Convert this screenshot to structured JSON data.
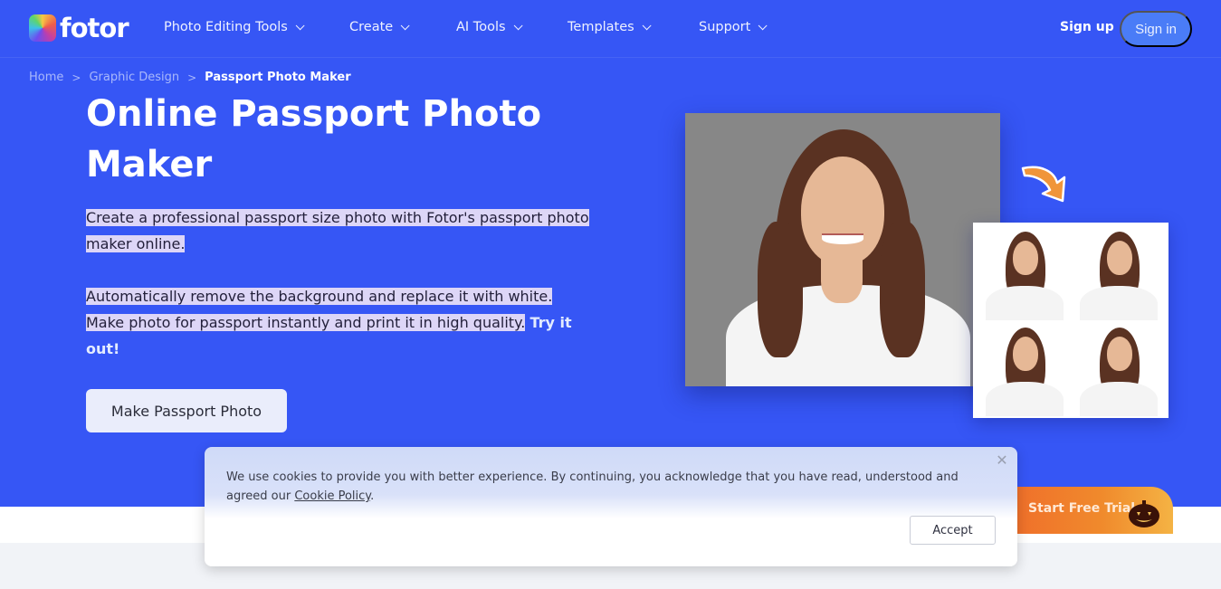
{
  "brand": {
    "name": "fotor",
    "accent": "#3656f5",
    "signin_bg": "#4a7cf7",
    "trial_gradient": [
      "#ef6a2a",
      "#f4b344"
    ]
  },
  "nav": {
    "items": [
      {
        "label": "Photo Editing Tools",
        "icon": "chevron-down-icon"
      },
      {
        "label": "Create",
        "icon": "chevron-down-icon"
      },
      {
        "label": "AI Tools",
        "icon": "chevron-down-icon"
      },
      {
        "label": "Templates",
        "icon": "chevron-down-icon"
      },
      {
        "label": "Support",
        "icon": "chevron-down-icon"
      }
    ],
    "signup": "Sign up",
    "signin": "Sign in"
  },
  "breadcrumb": {
    "items": [
      "Home",
      "Graphic Design"
    ],
    "current": "Passport Photo Maker",
    "separator": ">"
  },
  "hero": {
    "title": "Online Passport Photo Maker",
    "para1": "Create a professional passport size photo with Fotor's passport photo maker online.",
    "para2_highlighted": "Automatically remove the background and replace it with white. Make photo for passport instantly and print it in high quality.",
    "para2_link": "Try it out!",
    "cta": "Make Passport Photo",
    "images": {
      "main": "portrait-gray-background",
      "arrow": "orange-curved-arrow-icon",
      "result": "passport-photo-grid-2x2"
    }
  },
  "cookie": {
    "text_before": "We use cookies to provide you with better experience. By continuing, you acknowledge that you have read, understood and agreed our ",
    "link": "Cookie Policy",
    "text_after": ".",
    "accept": "Accept",
    "close_icon": "close-icon"
  },
  "trial": {
    "label": "Start Free Trial",
    "icon": "pumpkin-icon"
  }
}
